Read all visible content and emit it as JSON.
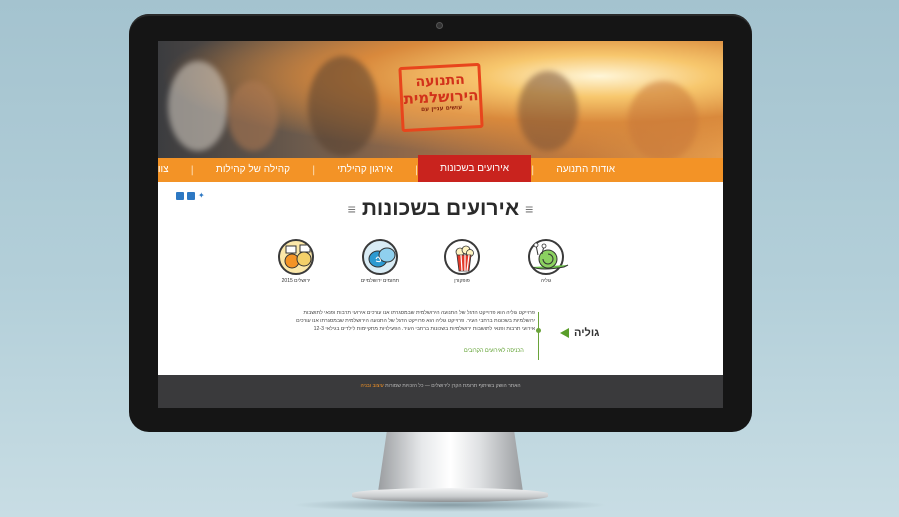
{
  "hero": {
    "logo_line1": "התנועה",
    "logo_line2": "הירושלמית",
    "logo_line3": "עושים עניין עם"
  },
  "nav": {
    "items": [
      {
        "label": "אודות התנועה",
        "active": false
      },
      {
        "label": "אירועים בשכונות",
        "active": true
      },
      {
        "label": "אירגון קהילתי",
        "active": false
      },
      {
        "label": "קהילה של קהילות",
        "active": false
      },
      {
        "label": "צוות התנועה",
        "active": false
      }
    ]
  },
  "page": {
    "title": "אירועים בשכונות",
    "bars": "≡"
  },
  "categories": [
    {
      "label": "גוליה",
      "icon": "snail-icon"
    },
    {
      "label": "פופקורן",
      "icon": "popcorn-icon"
    },
    {
      "label": "תחומים ירושלמיים",
      "icon": "speech-bubbles-icon"
    },
    {
      "label": "ירושלים 2015",
      "icon": "people-icon"
    }
  ],
  "content": {
    "description": "פרוייקט גוליה הוא פרוייקט הדגל של התנועה הירושלמית שבמסגרתו אנו עורכים אירועי תרבות ופנאי לתושבות ירושלמיות בשכונות ברחבי העיר. פרוייקט גוליה הוא פרוייקט הדגל של התנועה הירושלמית שבמסגרתו אנו עורכים אירועי תרבות ופנאי לתושבות ירושלמיות בשכונות ברחבי העיר. הפעילויות מתקיימות לילדים בגילאי 12-3",
    "more_link": "הכניסה לאירועים הקרובים",
    "side_label": "גוליה"
  },
  "footer": {
    "text": "האתר הושק בשיתוף תרומת הקרן לירושלים — כל הזכויות שמורות",
    "accent": "עיצוב ובניה"
  },
  "colors": {
    "nav_orange": "#f39326",
    "active_red": "#c9231e",
    "accent_green": "#5a9e2a"
  }
}
